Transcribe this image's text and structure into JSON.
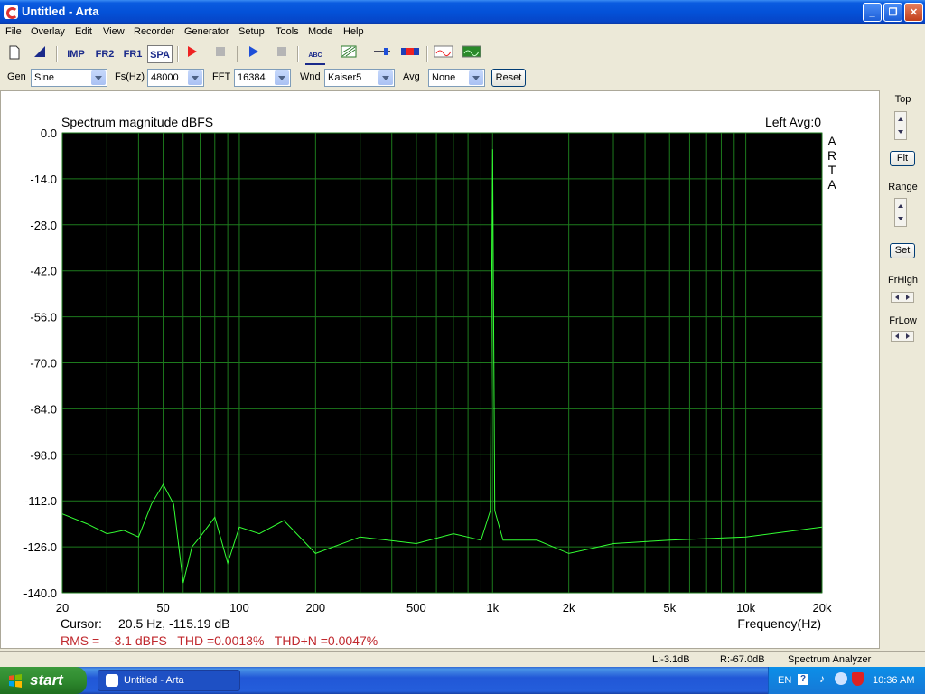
{
  "window": {
    "title": "Untitled - Arta"
  },
  "menu": [
    "File",
    "Overlay",
    "Edit",
    "View",
    "Recorder",
    "Generator",
    "Setup",
    "Tools",
    "Mode",
    "Help"
  ],
  "toolbar": {
    "imp": "IMP",
    "fr2": "FR2",
    "fr1": "FR1",
    "spa": "SPA",
    "abc": "ABC"
  },
  "controls": {
    "gen_label": "Gen",
    "gen_value": "Sine",
    "fs_label": "Fs(Hz)",
    "fs_value": "48000",
    "fft_label": "FFT",
    "fft_value": "16384",
    "wnd_label": "Wnd",
    "wnd_value": "Kaiser5",
    "avg_label": "Avg",
    "avg_value": "None",
    "reset_label": "Reset"
  },
  "side": {
    "top": "Top",
    "fit": "Fit",
    "range": "Range",
    "set": "Set",
    "frhigh": "FrHigh",
    "frlow": "FrLow"
  },
  "plot": {
    "channel": "Left  Avg:0",
    "brand": "ARTA",
    "cursor_label": "Cursor:",
    "cursor_value": "20.5 Hz, -115.19 dB",
    "rms": "RMS =   -3.1 dBFS   THD =0.0013%   THD+N =0.0047%"
  },
  "chart_data": {
    "type": "line",
    "title": "Spectrum magnitude dBFS",
    "xlabel": "Frequency(Hz)",
    "ylabel": "",
    "xscale": "log",
    "xlim": [
      20,
      20000
    ],
    "ylim": [
      -140,
      0
    ],
    "x_ticks": [
      20,
      50,
      100,
      200,
      500,
      1000,
      2000,
      5000,
      10000,
      20000
    ],
    "x_tick_labels": [
      "20",
      "50",
      "100",
      "200",
      "500",
      "1k",
      "2k",
      "5k",
      "10k",
      "20k"
    ],
    "y_ticks": [
      0,
      -14,
      -28,
      -42,
      -56,
      -70,
      -84,
      -98,
      -112,
      -126,
      -140
    ],
    "y_tick_labels": [
      "0.0",
      "-14.0",
      "-28.0",
      "-42.0",
      "-56.0",
      "-70.0",
      "-84.0",
      "-98.0",
      "-112.0",
      "-126.0",
      "-140.0"
    ],
    "grid": true,
    "line_color": "#33ff33",
    "background": "#000000",
    "series": [
      {
        "x": [
          20,
          25,
          30,
          35,
          40,
          45,
          50,
          55,
          60,
          65,
          70,
          80,
          90,
          100,
          120,
          150,
          200,
          300,
          500,
          700,
          900,
          980,
          1000,
          1020,
          1100,
          1500,
          2000,
          3000,
          5000,
          10000,
          20000
        ],
        "y": [
          -116,
          -119,
          -122,
          -121,
          -123,
          -113,
          -107,
          -113,
          -137,
          -126,
          -123,
          -117,
          -131,
          -120,
          -122,
          -118,
          -128,
          -123,
          -125,
          -122,
          -124,
          -115,
          -5,
          -115,
          -124,
          -124,
          -128,
          -125,
          -124,
          -123,
          -120
        ]
      }
    ]
  },
  "status": {
    "left": "L:-3.1dB",
    "right": "R:-67.0dB",
    "mode": "Spectrum Analyzer"
  },
  "taskbar": {
    "start": "start",
    "task": "Untitled - Arta",
    "lang": "EN",
    "time": "10:36 AM"
  }
}
